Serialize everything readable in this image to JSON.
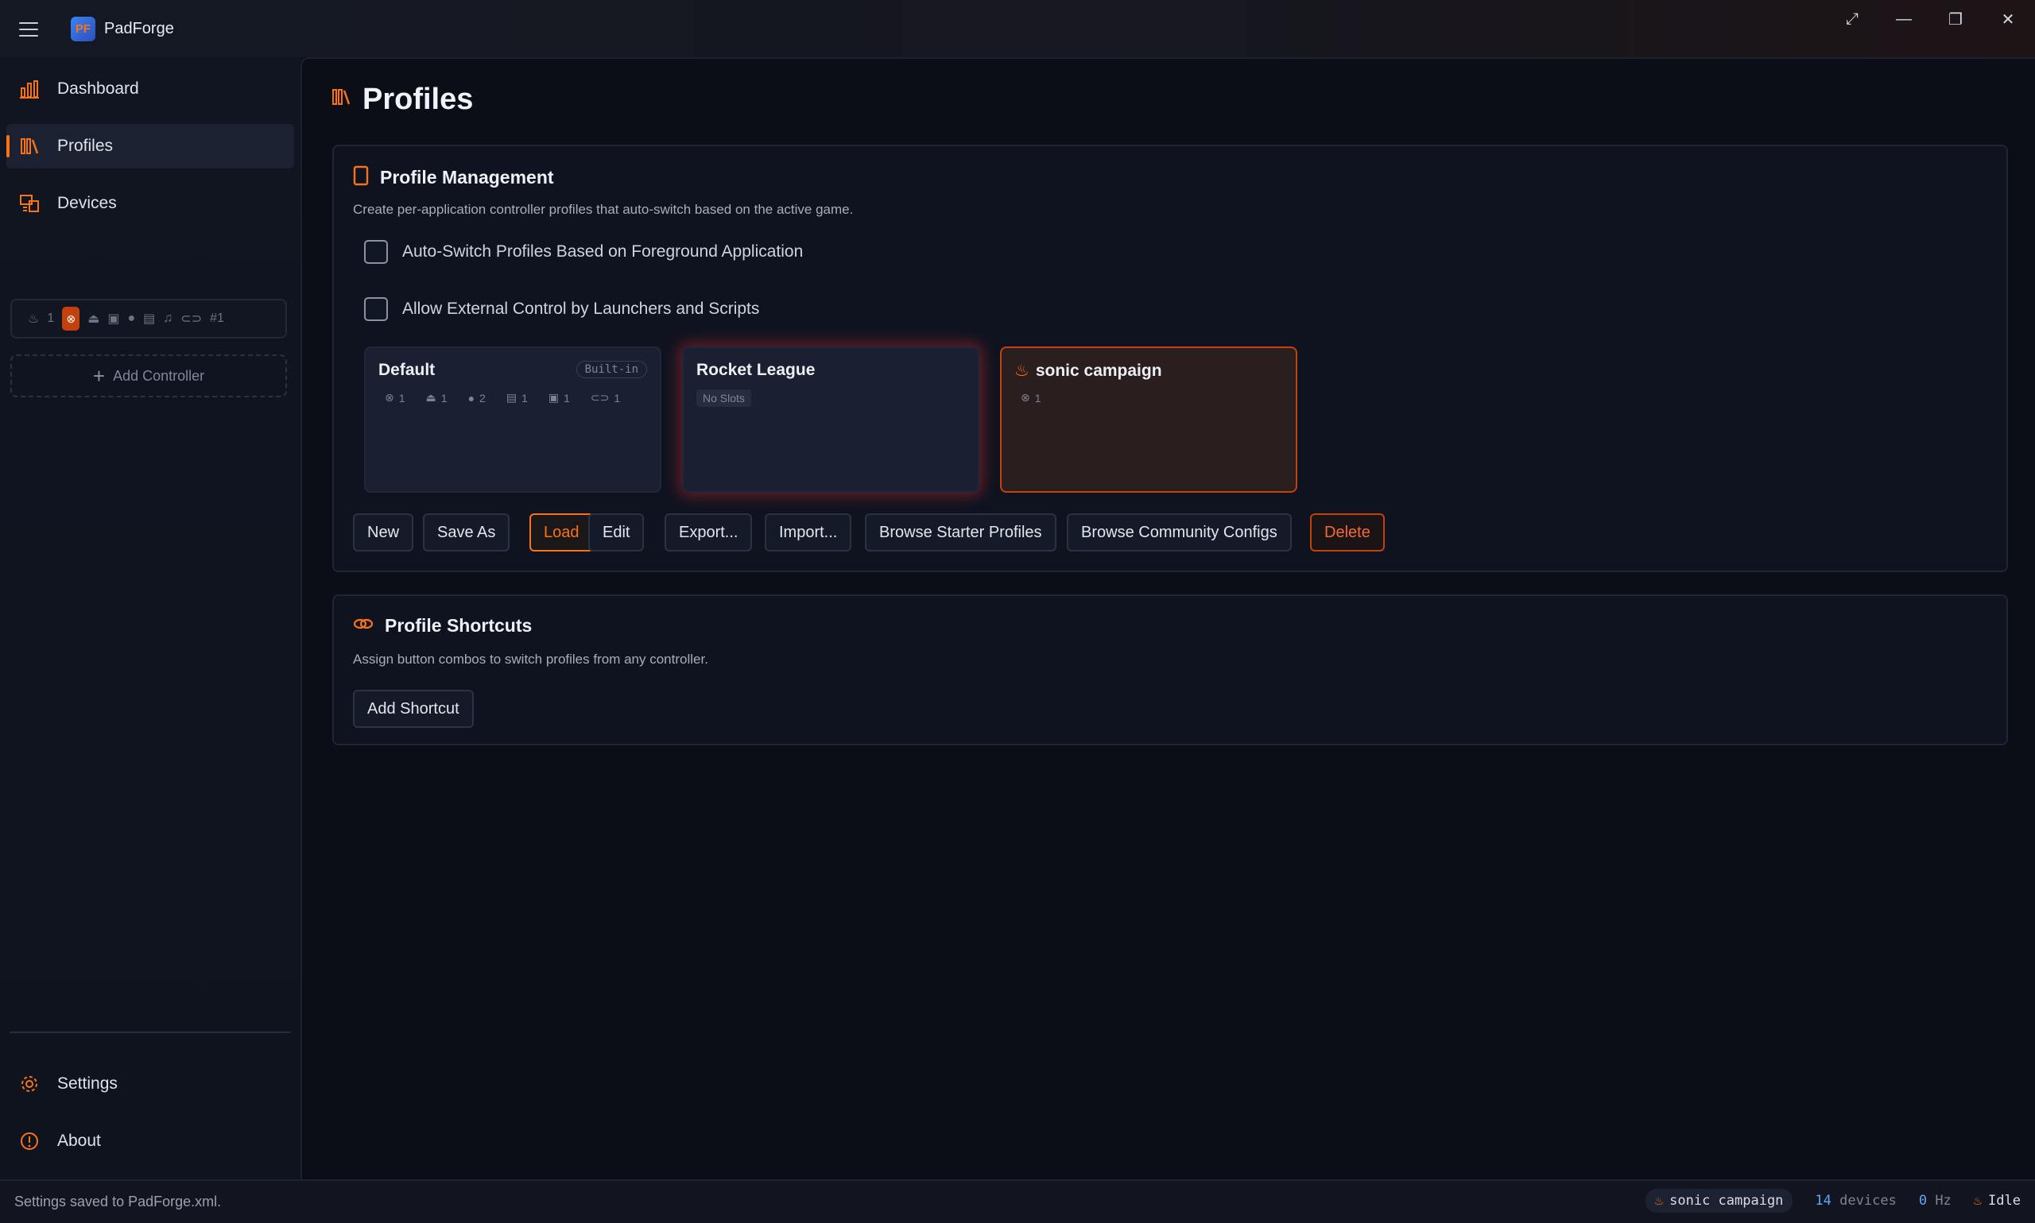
{
  "app": {
    "title": "PadForge",
    "logo_text": "PF"
  },
  "window_controls": {
    "fullscreen": "⤢",
    "minimize": "—",
    "restore": "❐",
    "close": "✕"
  },
  "sidebar": {
    "items": [
      {
        "label": "Dashboard",
        "icon": "dashboard-icon"
      },
      {
        "label": "Profiles",
        "icon": "profiles-icon",
        "active": true
      },
      {
        "label": "Devices",
        "icon": "devices-icon"
      }
    ],
    "controller_slot": {
      "count": "1",
      "slot_label": "#1"
    },
    "add_controller": "Add Controller",
    "bottom": [
      {
        "label": "Settings",
        "icon": "gear-icon"
      },
      {
        "label": "About",
        "icon": "info-icon"
      }
    ]
  },
  "page": {
    "title": "Profiles"
  },
  "profile_management": {
    "title": "Profile Management",
    "description": "Create per-application controller profiles that auto-switch based on the active game.",
    "options": [
      {
        "label": "Auto-Switch Profiles Based on Foreground Application",
        "checked": false
      },
      {
        "label": "Allow External Control by Launchers and Scripts",
        "checked": false
      }
    ],
    "profiles": [
      {
        "name": "Default",
        "badge": "Built-in",
        "stats": [
          "1",
          "1",
          "2",
          "1",
          "1",
          "1"
        ]
      },
      {
        "name": "Rocket League",
        "empty_label": "No Slots"
      },
      {
        "name": "sonic campaign",
        "active": true,
        "stats": [
          "1"
        ]
      }
    ],
    "buttons": {
      "new": "New",
      "save_as": "Save As",
      "load": "Load",
      "edit": "Edit",
      "export": "Export...",
      "import": "Import...",
      "browse_starter": "Browse Starter Profiles",
      "browse_community": "Browse Community Configs",
      "delete": "Delete"
    }
  },
  "profile_shortcuts": {
    "title": "Profile Shortcuts",
    "description": "Assign button combos to switch profiles from any controller.",
    "add_button": "Add Shortcut"
  },
  "status_bar": {
    "message": "Settings saved to PadForge.xml.",
    "active_profile": "sonic campaign",
    "device_count": "14",
    "device_label": "devices",
    "hz_value": "0",
    "hz_label": "Hz",
    "state": "Idle"
  },
  "colors": {
    "accent": "#f97316",
    "danger": "#c2410c",
    "info": "#60a5fa"
  }
}
